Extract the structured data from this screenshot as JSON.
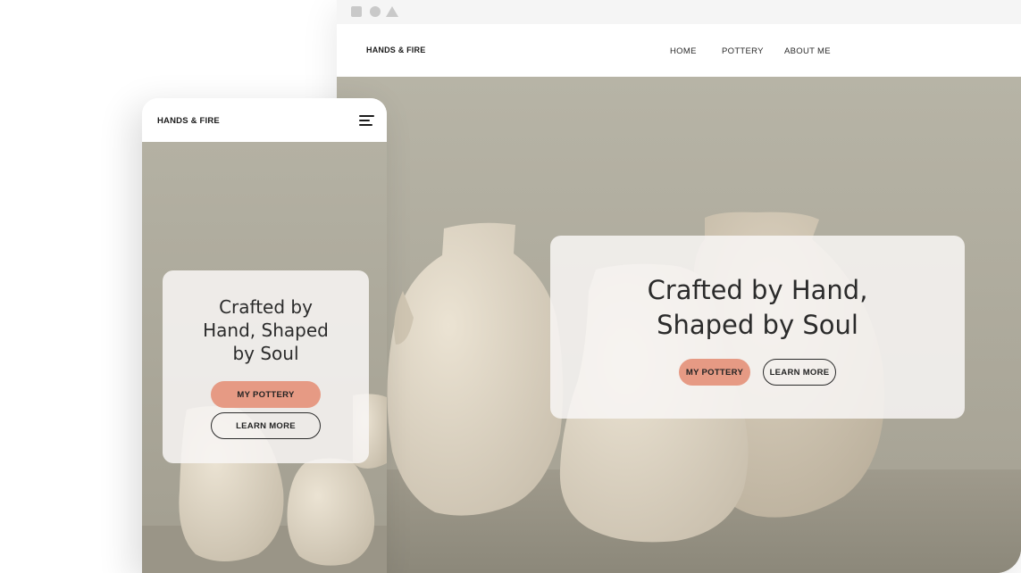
{
  "desktop": {
    "nav": {
      "brand": "HANDS & FIRE",
      "links": [
        "HOME",
        "POTTERY",
        "ABOUT ME"
      ]
    },
    "hero": {
      "headline_line1": "Crafted by Hand,",
      "headline_line2": "Shaped by Soul",
      "primary_button": "MY POTTERY",
      "secondary_button": "LEARN MORE"
    }
  },
  "mobile": {
    "nav": {
      "brand": "HANDS & FIRE"
    },
    "hero": {
      "headline_line1": "Crafted by",
      "headline_line2": "Hand, Shaped",
      "headline_line3": "by Soul",
      "primary_button": "MY POTTERY",
      "secondary_button": "LEARN MORE"
    }
  },
  "colors": {
    "accent": "#e69a84",
    "text": "#2b2b2b",
    "hero_background": "#aeab9d",
    "pottery": "#e3dac8"
  },
  "icons": [
    "window-square-icon",
    "window-circle-icon",
    "window-triangle-icon",
    "hamburger-menu-icon"
  ]
}
